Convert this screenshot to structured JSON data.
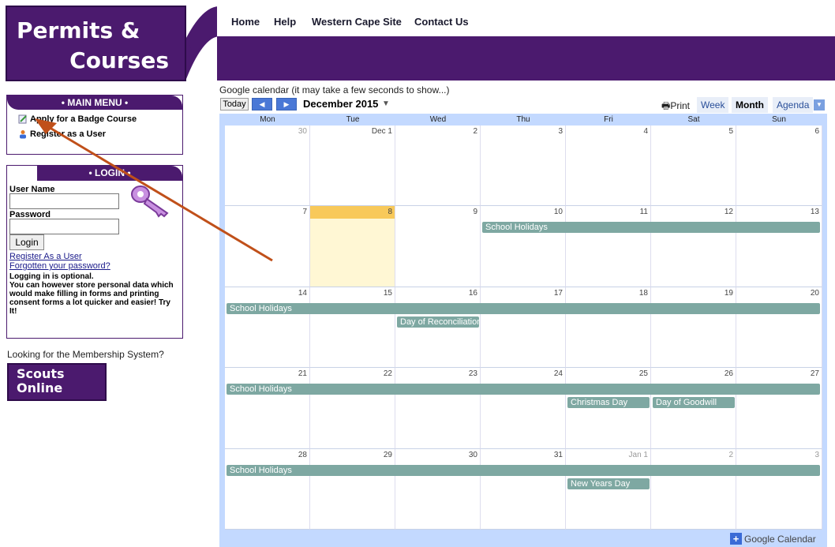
{
  "logo": {
    "line1": "Permits &",
    "line2": "Courses"
  },
  "nav": {
    "items": [
      "Home",
      "Help",
      "Western Cape Site",
      "Contact Us"
    ]
  },
  "main_menu": {
    "title": "• MAIN MENU •",
    "items": [
      "Apply for a Badge Course",
      "Register as a User"
    ]
  },
  "login": {
    "title": "• LOGIN •",
    "username_label": "User Name",
    "password_label": "Password",
    "button": "Login",
    "register_link": "Register As a User",
    "forgot_link": "Forgotten your password?",
    "note": "Logging in is optional.\nYou can however store personal data which would make filling in forms and printing consent forms a lot quicker and easier! Try It!"
  },
  "membership_question": "Looking for the Membership System?",
  "scouts_online": {
    "line1": "Scouts",
    "line2": "Online"
  },
  "calendar": {
    "caption": "Google calendar (it may take a few seconds to show...)",
    "today_btn": "Today",
    "month_label": "December 2015",
    "print": "Print",
    "views": [
      "Week",
      "Month",
      "Agenda"
    ],
    "active_view": "Month",
    "weekdays": [
      "Mon",
      "Tue",
      "Wed",
      "Thu",
      "Fri",
      "Sat",
      "Sun"
    ],
    "weeks": [
      [
        "30",
        "Dec 1",
        "2",
        "3",
        "4",
        "5",
        "6"
      ],
      [
        "7",
        "8",
        "9",
        "10",
        "11",
        "12",
        "13"
      ],
      [
        "14",
        "15",
        "16",
        "17",
        "18",
        "19",
        "20"
      ],
      [
        "21",
        "22",
        "23",
        "24",
        "25",
        "26",
        "27"
      ],
      [
        "28",
        "29",
        "30",
        "31",
        "Jan 1",
        "2",
        "3"
      ]
    ],
    "other_month": [
      [
        0,
        0
      ],
      [
        4,
        4
      ],
      [
        4,
        5
      ],
      [
        4,
        6
      ]
    ],
    "today_cell": [
      1,
      1
    ],
    "events": [
      {
        "label": "School Holidays",
        "week": 1,
        "start": 3,
        "span": 4,
        "row": 0
      },
      {
        "label": "School Holidays",
        "week": 2,
        "start": 0,
        "span": 7,
        "row": 0
      },
      {
        "label": "Day of Reconciliation",
        "week": 2,
        "start": 2,
        "span": 1,
        "row": 1
      },
      {
        "label": "School Holidays",
        "week": 3,
        "start": 0,
        "span": 7,
        "row": 0
      },
      {
        "label": "Christmas Day",
        "week": 3,
        "start": 4,
        "span": 1,
        "row": 1
      },
      {
        "label": "Day of Goodwill",
        "week": 3,
        "start": 5,
        "span": 1,
        "row": 1
      },
      {
        "label": "School Holidays",
        "week": 4,
        "start": 0,
        "span": 7,
        "row": 0
      },
      {
        "label": "New Years Day",
        "week": 4,
        "start": 4,
        "span": 1,
        "row": 1
      }
    ],
    "footer": "Google Calendar",
    "event_color": "#7ea8a2"
  },
  "colors": {
    "brand": "#4b1a6e",
    "today": "#f8c95a",
    "annotation_arrow": "#c0501a"
  }
}
